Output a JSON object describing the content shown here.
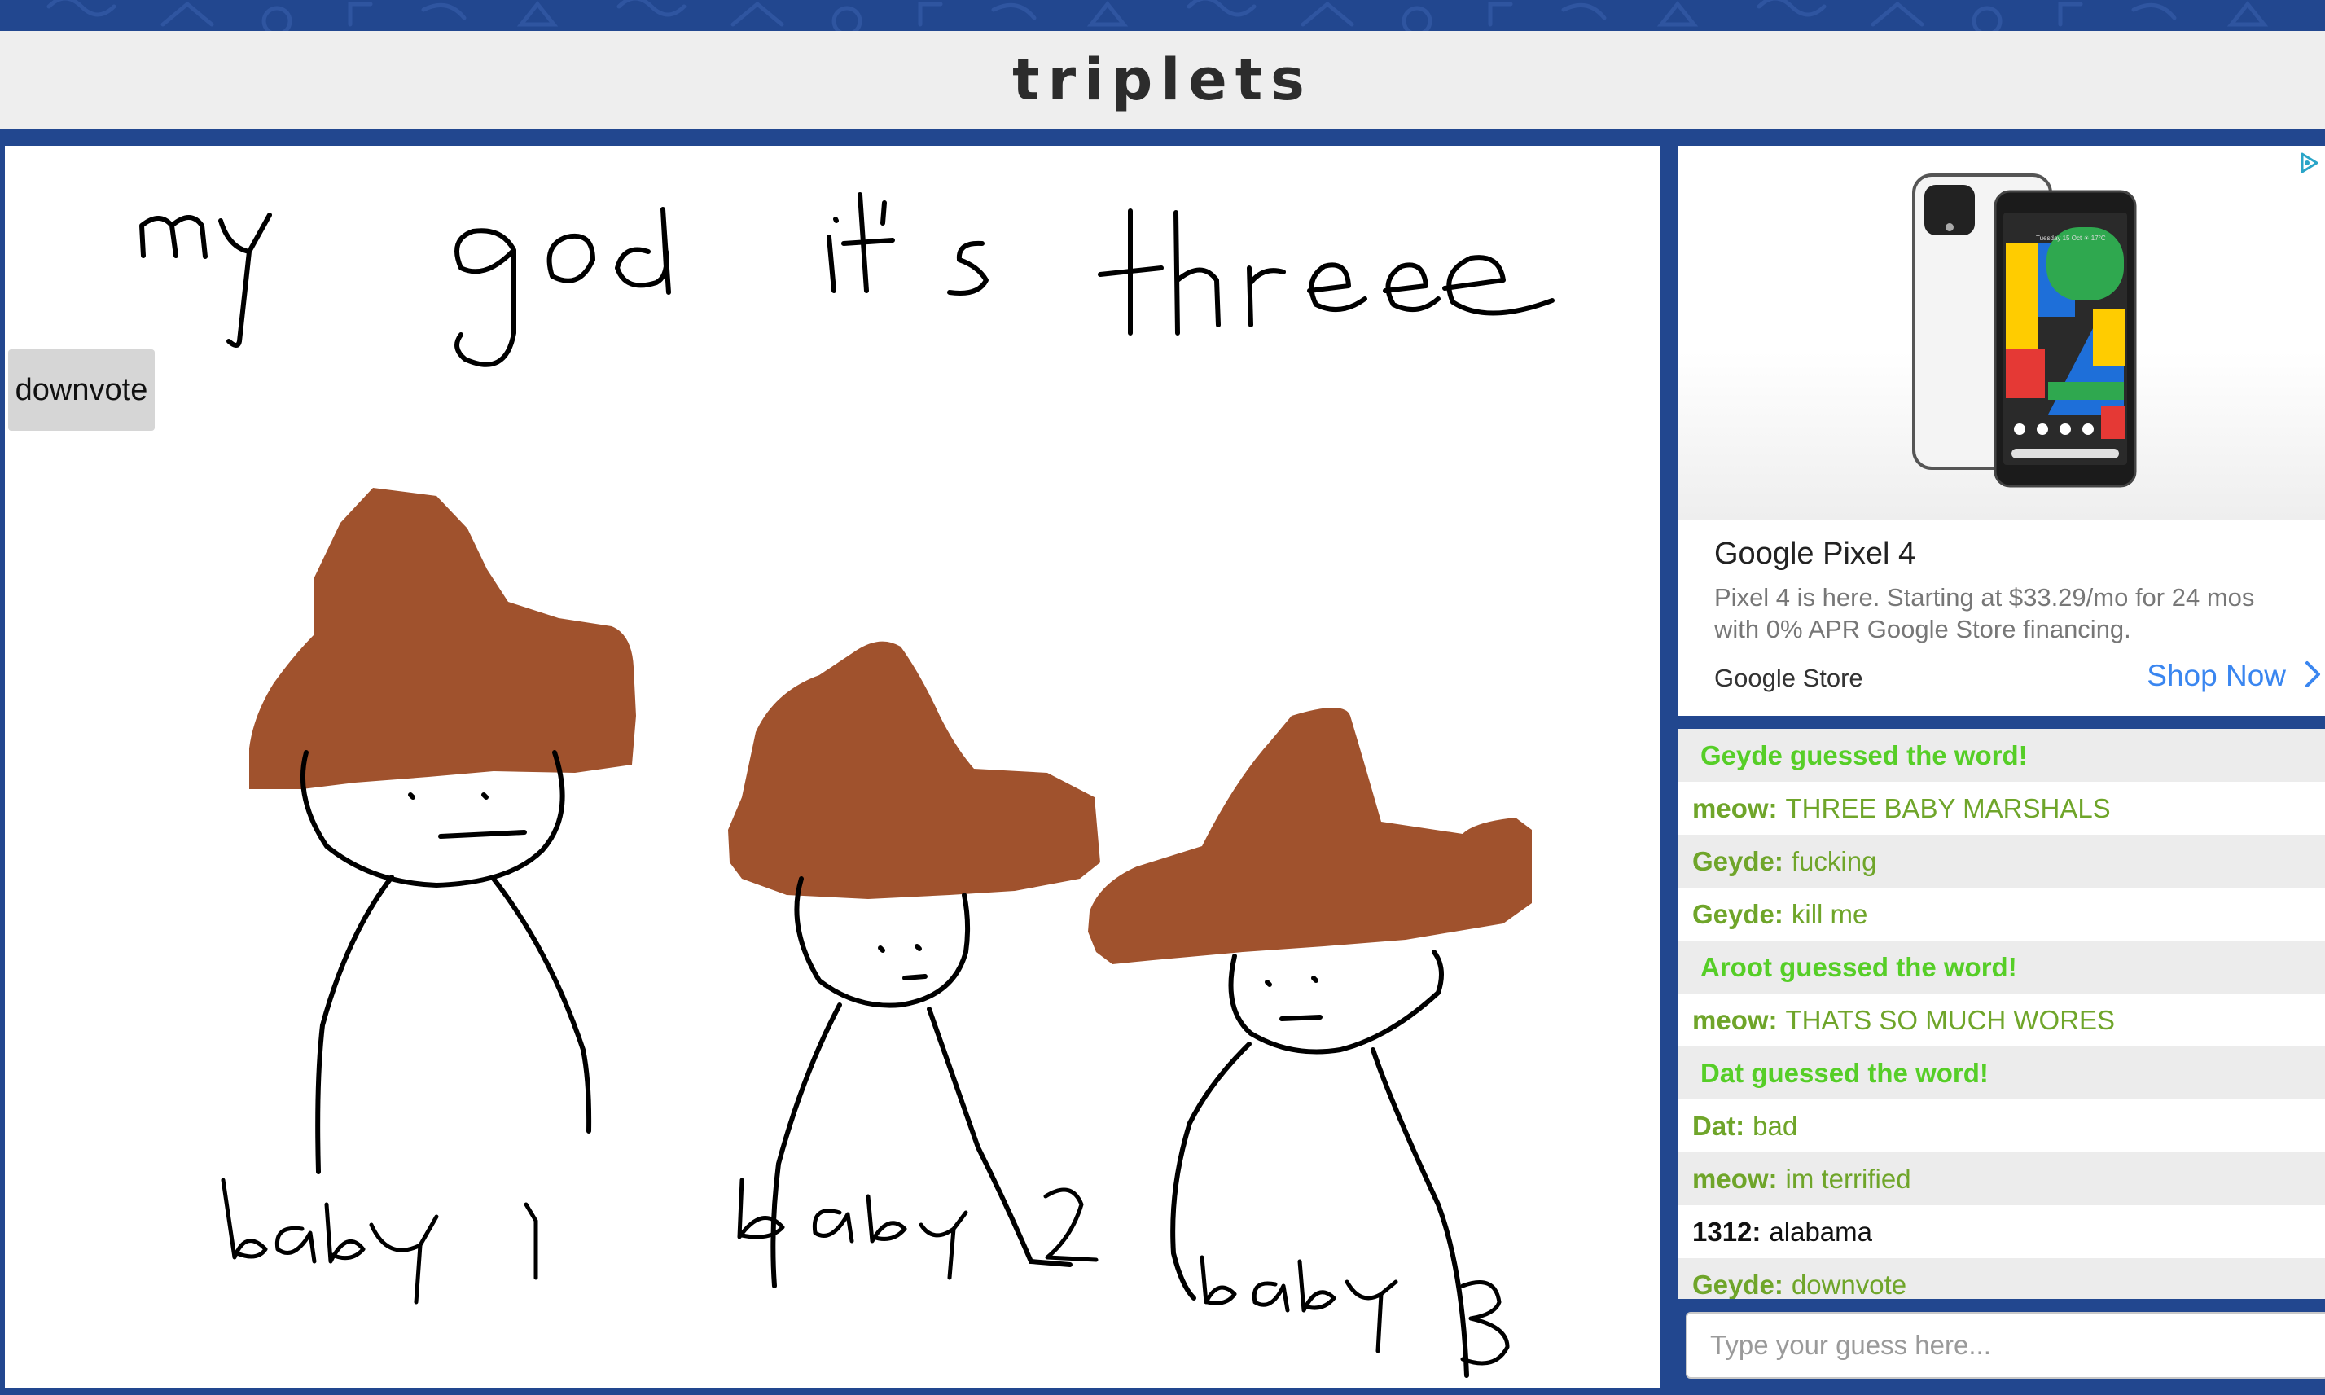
{
  "room": {
    "title": "triplets"
  },
  "controls": {
    "downvote_label": "downvote"
  },
  "ad": {
    "headline": "Google Pixel 4",
    "body": "Pixel 4 is here. Starting at $33.29/mo for 24 mos with 0% APR Google Store financing.",
    "advertiser": "Google Store",
    "cta": "Shop Now",
    "phone_screen_text": "Tuesday 15 Oct  ☀ 17°C",
    "icons": [
      "ad-choices-icon",
      "chevron-right-icon"
    ]
  },
  "drawing": {
    "caption": "my god it's three",
    "labels": [
      "baby 1",
      "baby 2",
      "baby 3"
    ],
    "colors": {
      "hat": "#a0522d",
      "ink": "#000000"
    }
  },
  "chat": {
    "messages": [
      {
        "kind": "system",
        "author": "",
        "text": "Geyde guessed the word!"
      },
      {
        "kind": "guess",
        "author": "meow:",
        "text": "THREE BABY MARSHALS"
      },
      {
        "kind": "guess",
        "author": "Geyde:",
        "text": "fucking"
      },
      {
        "kind": "guess",
        "author": "Geyde:",
        "text": "kill me"
      },
      {
        "kind": "system",
        "author": "",
        "text": "Aroot guessed the word!"
      },
      {
        "kind": "guess",
        "author": "meow:",
        "text": "THATS SO MUCH WORES"
      },
      {
        "kind": "system",
        "author": "",
        "text": "Dat guessed the word!"
      },
      {
        "kind": "guess",
        "author": "Dat:",
        "text": "bad"
      },
      {
        "kind": "guess",
        "author": "meow:",
        "text": "im terrified"
      },
      {
        "kind": "plain",
        "author": "1312:",
        "text": "alabama"
      },
      {
        "kind": "guess",
        "author": "Geyde:",
        "text": "downvote"
      }
    ],
    "input_placeholder": "Type your guess here..."
  },
  "colors": {
    "background": "#22478f",
    "title_bar": "#eeeeee",
    "system_message": "#56ce27",
    "guess_message": "#6fa52a",
    "cta": "#3a86f0"
  }
}
